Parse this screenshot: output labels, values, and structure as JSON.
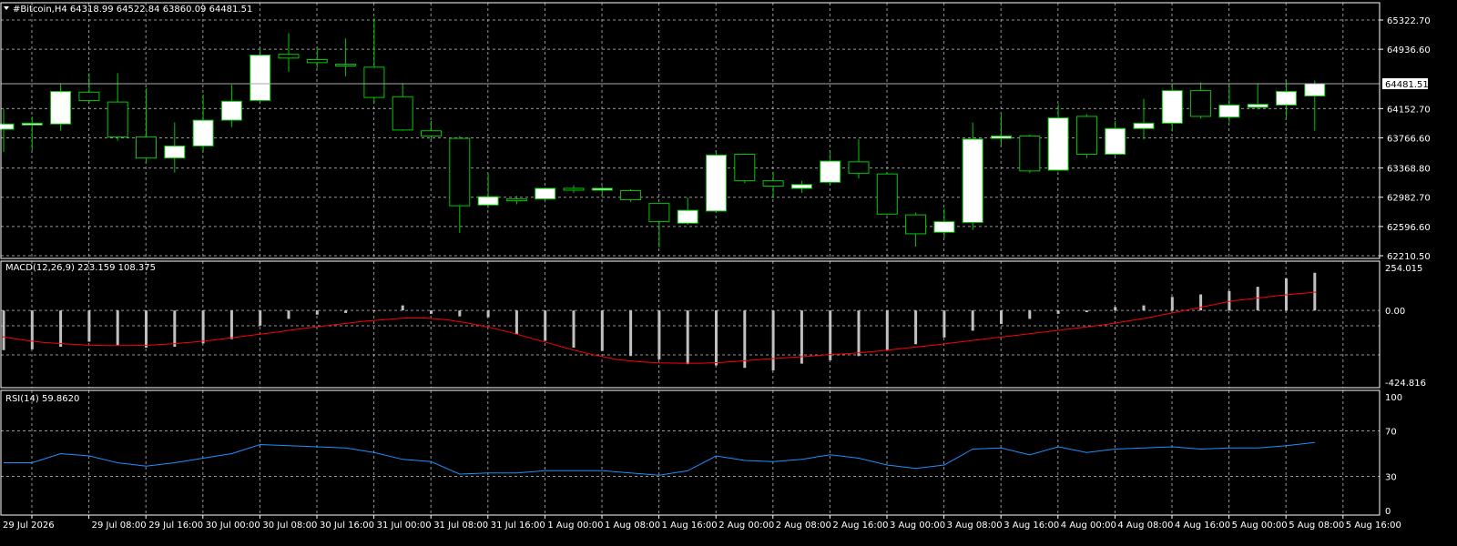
{
  "main_panel": {
    "symbol_line": "#Bitcoin,H4  64318.99 64522.84 63860.09 64481.51",
    "price_ticks": [
      "65322.70",
      "64936.60",
      "64152.70",
      "63766.60",
      "63368.80",
      "62982.70",
      "62596.60",
      "62210.50"
    ],
    "current_price_label": "64481.51"
  },
  "macd_panel": {
    "title": "MACD(12,26,9) 223.159 108.375",
    "ticks": [
      "254.015",
      "0.00",
      "-424.816"
    ]
  },
  "rsi_panel": {
    "title": "RSI(14) 59.8620",
    "ticks": [
      "100",
      "70",
      "30",
      "0"
    ]
  },
  "time_axis": {
    "labels": [
      "29 Jul 2026",
      "29 Jul 08:00",
      "29 Jul 16:00",
      "30 Jul 00:00",
      "30 Jul 08:00",
      "30 Jul 16:00",
      "31 Jul 00:00",
      "31 Jul 08:00",
      "31 Jul 16:00",
      "1 Aug 00:00",
      "1 Aug 08:00",
      "1 Aug 16:00",
      "2 Aug 00:00",
      "2 Aug 08:00",
      "2 Aug 16:00",
      "3 Aug 00:00",
      "3 Aug 08:00",
      "3 Aug 16:00",
      "4 Aug 00:00",
      "4 Aug 08:00",
      "4 Aug 16:00",
      "5 Aug 00:00",
      "5 Aug 08:00",
      "5 Aug 16:00"
    ]
  },
  "colors": {
    "background": "#000000",
    "grid": "#c8c8c8",
    "bull_body": "#ffffff",
    "bear_body": "#000000",
    "candle_outline": "#00c800",
    "macd_histogram": "#c0c0c0",
    "macd_signal": "#ff0000",
    "rsi_line": "#1e90ff",
    "text": "#ffffff"
  },
  "chart_data": [
    {
      "type": "candlestick",
      "title": "#Bitcoin,H4",
      "timeframe": "H4",
      "ylim": [
        62210.5,
        65450
      ],
      "y_ticks": [
        62210.5,
        62596.6,
        62982.7,
        63368.8,
        63766.6,
        64152.7,
        64936.6,
        65322.7
      ],
      "last_price": 64481.51,
      "candles": [
        {
          "o": 63880,
          "h": 64150,
          "l": 63580,
          "c": 63950
        },
        {
          "o": 63960,
          "h": 64050,
          "l": 63600,
          "c": 63960
        },
        {
          "o": 63950,
          "h": 64480,
          "l": 63860,
          "c": 64380
        },
        {
          "o": 64370,
          "h": 64620,
          "l": 64230,
          "c": 64260
        },
        {
          "o": 64240,
          "h": 64620,
          "l": 63730,
          "c": 63780
        },
        {
          "o": 63780,
          "h": 64420,
          "l": 63440,
          "c": 63500
        },
        {
          "o": 63500,
          "h": 63970,
          "l": 63310,
          "c": 63660
        },
        {
          "o": 63660,
          "h": 64340,
          "l": 63580,
          "c": 64000
        },
        {
          "o": 64000,
          "h": 64470,
          "l": 63910,
          "c": 64250
        },
        {
          "o": 64260,
          "h": 64950,
          "l": 64230,
          "c": 64860
        },
        {
          "o": 64870,
          "h": 65150,
          "l": 64640,
          "c": 64820
        },
        {
          "o": 64800,
          "h": 64960,
          "l": 64690,
          "c": 64760
        },
        {
          "o": 64740,
          "h": 65080,
          "l": 64580,
          "c": 64720
        },
        {
          "o": 64700,
          "h": 65350,
          "l": 64220,
          "c": 64300
        },
        {
          "o": 64310,
          "h": 64490,
          "l": 63860,
          "c": 63870
        },
        {
          "o": 63860,
          "h": 63990,
          "l": 63740,
          "c": 63790
        },
        {
          "o": 63760,
          "h": 63790,
          "l": 62510,
          "c": 62870
        },
        {
          "o": 62880,
          "h": 63300,
          "l": 62840,
          "c": 62990
        },
        {
          "o": 62960,
          "h": 63000,
          "l": 62890,
          "c": 62940
        },
        {
          "o": 62960,
          "h": 63110,
          "l": 62950,
          "c": 63100
        },
        {
          "o": 63100,
          "h": 63140,
          "l": 63040,
          "c": 63080
        },
        {
          "o": 63080,
          "h": 63130,
          "l": 63010,
          "c": 63100
        },
        {
          "o": 63070,
          "h": 63090,
          "l": 62920,
          "c": 62950
        },
        {
          "o": 62900,
          "h": 62910,
          "l": 62320,
          "c": 62660
        },
        {
          "o": 62640,
          "h": 62980,
          "l": 62620,
          "c": 62810
        },
        {
          "o": 62800,
          "h": 63570,
          "l": 62790,
          "c": 63540
        },
        {
          "o": 63550,
          "h": 63560,
          "l": 63170,
          "c": 63200
        },
        {
          "o": 63200,
          "h": 63320,
          "l": 62970,
          "c": 63130
        },
        {
          "o": 63100,
          "h": 63200,
          "l": 63040,
          "c": 63150
        },
        {
          "o": 63180,
          "h": 63590,
          "l": 63140,
          "c": 63460
        },
        {
          "o": 63450,
          "h": 63750,
          "l": 63230,
          "c": 63300
        },
        {
          "o": 63290,
          "h": 63310,
          "l": 62750,
          "c": 62760
        },
        {
          "o": 62750,
          "h": 62780,
          "l": 62330,
          "c": 62500
        },
        {
          "o": 62520,
          "h": 62830,
          "l": 62450,
          "c": 62660
        },
        {
          "o": 62650,
          "h": 63970,
          "l": 62550,
          "c": 63750
        },
        {
          "o": 63760,
          "h": 64080,
          "l": 63670,
          "c": 63790
        },
        {
          "o": 63790,
          "h": 63810,
          "l": 63300,
          "c": 63330
        },
        {
          "o": 63340,
          "h": 64210,
          "l": 63330,
          "c": 64030
        },
        {
          "o": 64050,
          "h": 64080,
          "l": 63500,
          "c": 63550
        },
        {
          "o": 63550,
          "h": 63990,
          "l": 63520,
          "c": 63890
        },
        {
          "o": 63890,
          "h": 64280,
          "l": 63750,
          "c": 63960
        },
        {
          "o": 63960,
          "h": 64480,
          "l": 63850,
          "c": 64390
        },
        {
          "o": 64390,
          "h": 64500,
          "l": 64020,
          "c": 64050
        },
        {
          "o": 64040,
          "h": 64490,
          "l": 63970,
          "c": 64200
        },
        {
          "o": 64170,
          "h": 64490,
          "l": 64140,
          "c": 64210
        },
        {
          "o": 64200,
          "h": 64530,
          "l": 64020,
          "c": 64380
        },
        {
          "o": 64318.99,
          "h": 64522.84,
          "l": 63860.09,
          "c": 64481.51
        }
      ]
    },
    {
      "type": "bar+line",
      "title": "MACD(12,26,9)",
      "parameters": [
        12,
        26,
        9
      ],
      "macd_last": 223.159,
      "signal_last": 108.375,
      "ylim": [
        -424.816,
        254.015
      ],
      "histogram": [
        -235,
        -230,
        -215,
        -185,
        -205,
        -220,
        -215,
        -195,
        -170,
        -90,
        -50,
        -25,
        -15,
        -5,
        30,
        -20,
        -35,
        -40,
        -140,
        -180,
        -220,
        -240,
        -270,
        -290,
        -318,
        -325,
        -340,
        -355,
        -315,
        -295,
        -270,
        -235,
        -200,
        -160,
        -120,
        -80,
        -50,
        -20,
        -10,
        20,
        30,
        80,
        95,
        115,
        140,
        190,
        223.159
      ],
      "signal": [
        -155,
        -175,
        -190,
        -198,
        -205,
        -208,
        -208,
        -205,
        -198,
        -188,
        -175,
        -160,
        -143,
        -128,
        -110,
        -95,
        -80,
        -65,
        -55,
        -45,
        -45,
        -55,
        -75,
        -100,
        -130,
        -165,
        -200,
        -235,
        -265,
        -290,
        -303,
        -310,
        -312,
        -312,
        -308,
        -298,
        -288,
        -280,
        -272,
        -262,
        -255,
        -245,
        -232,
        -218,
        -205,
        -190,
        -175,
        -160,
        -145,
        -130,
        -115,
        -100,
        -85,
        -65,
        -45,
        -20,
        5,
        30,
        55,
        70,
        85,
        97,
        108.375
      ]
    },
    {
      "type": "line",
      "title": "RSI(14)",
      "period": 14,
      "last": 59.862,
      "ylim": [
        0,
        100
      ],
      "levels": [
        70,
        30
      ],
      "values": [
        42,
        42,
        50,
        48,
        42,
        39,
        42,
        46,
        50,
        58,
        57,
        56,
        55,
        51,
        45,
        43,
        32,
        33,
        33,
        35,
        35,
        35,
        33,
        31,
        35,
        48,
        44,
        43,
        45,
        49,
        46,
        40,
        37,
        40,
        54,
        55,
        49,
        56,
        51,
        54,
        55,
        56,
        54,
        55,
        55,
        57,
        59.862
      ]
    }
  ]
}
